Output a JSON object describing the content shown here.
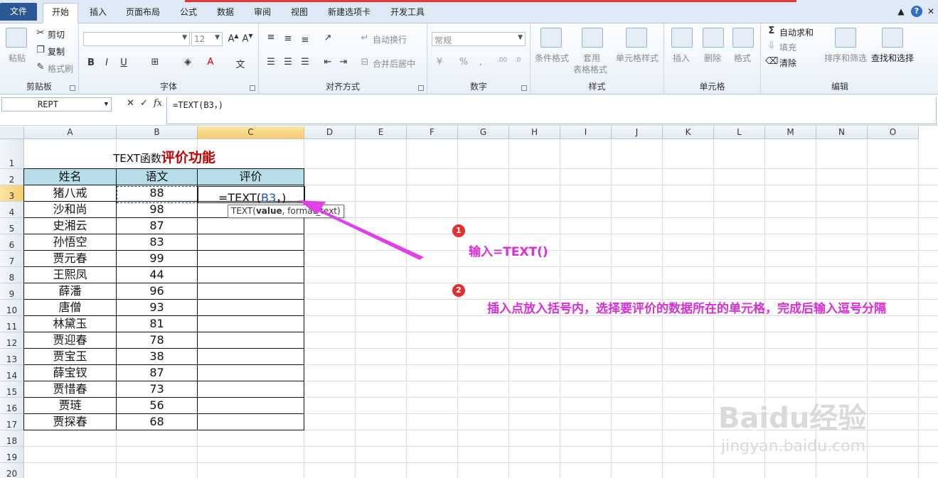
{
  "ribbon_tabs": {
    "file": "文件",
    "home": "开始",
    "insert": "插入",
    "page_layout": "页面布局",
    "formulas": "公式",
    "data": "数据",
    "review": "审阅",
    "view": "视图",
    "new_tab": "新建选项卡",
    "developer": "开发工具"
  },
  "clipboard": {
    "paste": "粘贴",
    "cut": "剪切",
    "copy": "复制",
    "format_painter": "格式刷",
    "label": "剪贴板"
  },
  "font": {
    "size": "12",
    "bold": "B",
    "italic": "I",
    "underline": "U",
    "label": "字体"
  },
  "alignment": {
    "wrap_text": "自动换行",
    "merge_center": "合并后居中",
    "label": "对齐方式"
  },
  "number": {
    "format": "常规",
    "label": "数字"
  },
  "styles": {
    "conditional": "条件格式",
    "as_table_1": "套用",
    "as_table_2": "表格格式",
    "cell_styles": "单元格样式",
    "label": "样式"
  },
  "cells": {
    "insert": "插入",
    "delete": "删除",
    "format": "格式",
    "label": "单元格"
  },
  "editing": {
    "autosum": "自动求和",
    "fill": "填充",
    "clear": "清除",
    "sort_filter": "排序和筛选",
    "find_select": "查找和选择",
    "label": "编辑"
  },
  "formula_bar": {
    "name_box": "REPT",
    "fx": "fx",
    "formula": "=TEXT(B3，)"
  },
  "columns": [
    "A",
    "B",
    "C",
    "D",
    "E",
    "F",
    "G",
    "H",
    "I",
    "J",
    "K",
    "L",
    "M",
    "N",
    "O"
  ],
  "rows": [
    "1",
    "2",
    "3",
    "4",
    "5",
    "6",
    "7",
    "8",
    "9",
    "10",
    "11",
    "12",
    "13",
    "14",
    "15",
    "16",
    "17",
    "18",
    "19",
    "20"
  ],
  "sheet": {
    "title_part1": "TEXT函数",
    "title_part2": "评价功能",
    "headers": [
      "姓名",
      "语文",
      "评价"
    ],
    "records": [
      {
        "name": "猪八戒",
        "score": "88"
      },
      {
        "name": "沙和尚",
        "score": "98"
      },
      {
        "name": "史湘云",
        "score": "87"
      },
      {
        "name": "孙悟空",
        "score": "83"
      },
      {
        "name": "贾元春",
        "score": "99"
      },
      {
        "name": "王熙凤",
        "score": "44"
      },
      {
        "name": "薛潘",
        "score": "96"
      },
      {
        "name": "唐僧",
        "score": "93"
      },
      {
        "name": "林黛玉",
        "score": "81"
      },
      {
        "name": "贾迎春",
        "score": "78"
      },
      {
        "name": "贾宝玉",
        "score": "38"
      },
      {
        "name": "薛宝钗",
        "score": "87"
      },
      {
        "name": "贾惜春",
        "score": "73"
      },
      {
        "name": "贾琏",
        "score": "56"
      },
      {
        "name": "贾探春",
        "score": "68"
      }
    ],
    "editing_prefix": "=TEXT(",
    "editing_ref": "B3",
    "editing_suffix": "，)",
    "tooltip_pre": "TEXT(",
    "tooltip_arg1": "value",
    "tooltip_post": ", format_text)"
  },
  "annotations": {
    "badge1": "1",
    "step1": "输入=TEXT()",
    "badge2": "2",
    "step2": "插入点放入括号内，选择要评价的数据所在的单元格，完成后输入逗号分隔"
  },
  "watermark": {
    "brand": "Baidu经验",
    "url": "jingyan.baidu.com"
  },
  "colors": {
    "header_fill": "#b7dde8",
    "title_red": "#c00000",
    "annotation": "#d62fd6",
    "arrow": "#e040e8"
  }
}
